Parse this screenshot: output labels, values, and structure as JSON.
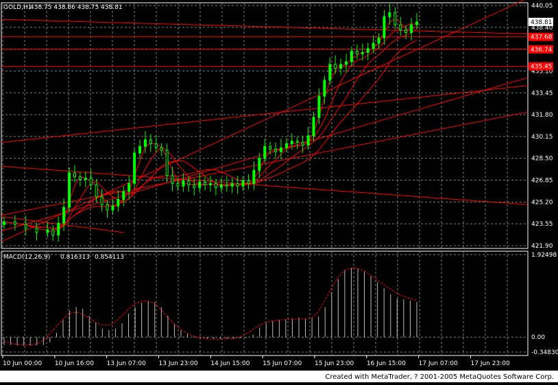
{
  "chart_data": {
    "type": "line",
    "symbol_label": "GOLD,H1",
    "ohlc_label": "438.75 438.86 438.75 438.81",
    "price_axis": {
      "range": [
        421.9,
        440.05
      ],
      "tick_labels": [
        "440.05",
        "438.40",
        "436.75",
        "435.10",
        "433.45",
        "431.80",
        "430.15",
        "428.50",
        "426.85",
        "425.20",
        "423.55",
        "421.90"
      ],
      "tick_values": [
        440.05,
        438.4,
        436.75,
        435.1,
        433.45,
        431.8,
        430.15,
        428.5,
        426.85,
        425.2,
        423.55,
        421.9
      ]
    },
    "current_price": {
      "label": "438.81",
      "value": 438.81
    },
    "price_levels": [
      {
        "label": "437.68",
        "value": 437.68
      },
      {
        "label": "436.74",
        "value": 436.74
      },
      {
        "label": "435.45",
        "value": 435.45
      }
    ],
    "time_labels": [
      "10 Jun 00:00",
      "10 Jun 16:00",
      "13 Jun 07:00",
      "13 Jun 23:00",
      "14 Jun 15:00",
      "15 Jun 07:00",
      "15 Jun 23:00",
      "16 Jun 15:00",
      "17 Jun 07:00",
      "17 Jun 23:00"
    ],
    "price_series": [
      {
        "t": 0,
        "c": 423.7
      },
      {
        "t": 4,
        "c": 423.5
      },
      {
        "t": 8,
        "c": 423.2
      },
      {
        "t": 12,
        "c": 422.9
      },
      {
        "t": 16,
        "c": 423.1
      },
      {
        "t": 18,
        "c": 422.7
      },
      {
        "t": 20,
        "c": 423.6
      },
      {
        "t": 22,
        "c": 424.8
      },
      {
        "t": 24,
        "c": 427.4
      },
      {
        "t": 26,
        "c": 427.1
      },
      {
        "t": 28,
        "c": 426.9
      },
      {
        "t": 30,
        "c": 427.0
      },
      {
        "t": 32,
        "c": 426.5
      },
      {
        "t": 34,
        "c": 425.6
      },
      {
        "t": 36,
        "c": 425.0
      },
      {
        "t": 38,
        "c": 424.6
      },
      {
        "t": 40,
        "c": 424.9
      },
      {
        "t": 42,
        "c": 425.4
      },
      {
        "t": 44,
        "c": 426.0
      },
      {
        "t": 46,
        "c": 426.6
      },
      {
        "t": 48,
        "c": 428.9
      },
      {
        "t": 50,
        "c": 429.4
      },
      {
        "t": 52,
        "c": 429.9
      },
      {
        "t": 54,
        "c": 429.6
      },
      {
        "t": 56,
        "c": 429.3
      },
      {
        "t": 58,
        "c": 429.1
      },
      {
        "t": 60,
        "c": 427.2
      },
      {
        "t": 62,
        "c": 426.6
      },
      {
        "t": 64,
        "c": 426.4
      },
      {
        "t": 66,
        "c": 426.8
      },
      {
        "t": 68,
        "c": 426.5
      },
      {
        "t": 70,
        "c": 426.3
      },
      {
        "t": 72,
        "c": 426.7
      },
      {
        "t": 74,
        "c": 426.5
      },
      {
        "t": 76,
        "c": 426.6
      },
      {
        "t": 78,
        "c": 426.3
      },
      {
        "t": 80,
        "c": 426.5
      },
      {
        "t": 82,
        "c": 426.4
      },
      {
        "t": 84,
        "c": 426.6
      },
      {
        "t": 86,
        "c": 426.4
      },
      {
        "t": 88,
        "c": 426.8
      },
      {
        "t": 90,
        "c": 426.6
      },
      {
        "t": 92,
        "c": 427.6
      },
      {
        "t": 94,
        "c": 428.5
      },
      {
        "t": 96,
        "c": 429.4
      },
      {
        "t": 98,
        "c": 429.2
      },
      {
        "t": 100,
        "c": 429.0
      },
      {
        "t": 102,
        "c": 429.3
      },
      {
        "t": 104,
        "c": 429.6
      },
      {
        "t": 106,
        "c": 429.8
      },
      {
        "t": 108,
        "c": 429.7
      },
      {
        "t": 110,
        "c": 429.5
      },
      {
        "t": 112,
        "c": 430.2
      },
      {
        "t": 114,
        "c": 431.6
      },
      {
        "t": 116,
        "c": 433.2
      },
      {
        "t": 118,
        "c": 434.4
      },
      {
        "t": 120,
        "c": 435.6
      },
      {
        "t": 122,
        "c": 435.3
      },
      {
        "t": 124,
        "c": 435.6
      },
      {
        "t": 126,
        "c": 435.8
      },
      {
        "t": 128,
        "c": 436.6
      },
      {
        "t": 130,
        "c": 436.4
      },
      {
        "t": 132,
        "c": 436.5
      },
      {
        "t": 134,
        "c": 436.8
      },
      {
        "t": 136,
        "c": 437.2
      },
      {
        "t": 138,
        "c": 437.6
      },
      {
        "t": 140,
        "c": 439.2
      },
      {
        "t": 142,
        "c": 439.5
      },
      {
        "t": 144,
        "c": 438.6
      },
      {
        "t": 146,
        "c": 438.2
      },
      {
        "t": 148,
        "c": 438.0
      },
      {
        "t": 150,
        "c": 438.6
      },
      {
        "t": 152,
        "c": 438.81
      }
    ],
    "macd": {
      "label": "MACD(12,26,9)",
      "main_label": "0.816313",
      "signal_label": "0.854113",
      "range": [
        -0.3483,
        1.92498
      ],
      "tick_labels": [
        "1.92498",
        "0.00",
        "-0.34830"
      ],
      "tick_values": [
        1.92498,
        0.0,
        -0.3483
      ],
      "histogram": [
        -0.18,
        -0.18,
        -0.19,
        -0.2,
        -0.2,
        -0.19,
        -0.18,
        -0.12,
        0.1,
        0.4,
        0.62,
        0.7,
        0.66,
        0.5,
        0.34,
        0.2,
        0.16,
        0.2,
        0.32,
        0.55,
        0.7,
        0.8,
        0.84,
        0.82,
        0.7,
        0.5,
        0.3,
        0.16,
        0.08,
        0.02,
        -0.02,
        -0.04,
        -0.05,
        -0.05,
        -0.04,
        -0.04,
        -0.03,
        -0.02,
        0.06,
        0.22,
        0.32,
        0.38,
        0.4,
        0.42,
        0.44,
        0.46,
        0.44,
        0.45,
        0.48,
        0.7,
        1.05,
        1.35,
        1.56,
        1.62,
        1.6,
        1.54,
        1.42,
        1.28,
        1.14,
        1.0,
        0.9,
        0.88,
        0.85,
        0.82
      ],
      "signal": [
        -0.1,
        -0.14,
        -0.17,
        -0.18,
        -0.18,
        -0.16,
        -0.08,
        0.08,
        0.25,
        0.42,
        0.55,
        0.58,
        0.54,
        0.44,
        0.34,
        0.28,
        0.28,
        0.35,
        0.5,
        0.66,
        0.78,
        0.84,
        0.84,
        0.78,
        0.64,
        0.46,
        0.3,
        0.18,
        0.08,
        0.02,
        -0.02,
        -0.04,
        -0.05,
        -0.05,
        -0.04,
        -0.03,
        0.0,
        0.08,
        0.18,
        0.28,
        0.35,
        0.38,
        0.4,
        0.41,
        0.42,
        0.42,
        0.42,
        0.45,
        0.6,
        0.86,
        1.15,
        1.4,
        1.56,
        1.62,
        1.6,
        1.54,
        1.44,
        1.32,
        1.22,
        1.12,
        1.02,
        0.95,
        0.9,
        0.854
      ]
    }
  },
  "footer_text": "Created with MetaTrader, ? 2001-2005 MetaQuotes Software Corp.",
  "colors": {
    "background": "#000000",
    "candle_up": "#00ff00",
    "candle_down": "#00ff00",
    "grid": "#7f7f7f",
    "indicator": "#ff0000",
    "axis_text": "#ffffff",
    "macd_hist": "#c0c0c0",
    "macd_signal": "#ff0000",
    "level_tag": "#ff0000"
  }
}
